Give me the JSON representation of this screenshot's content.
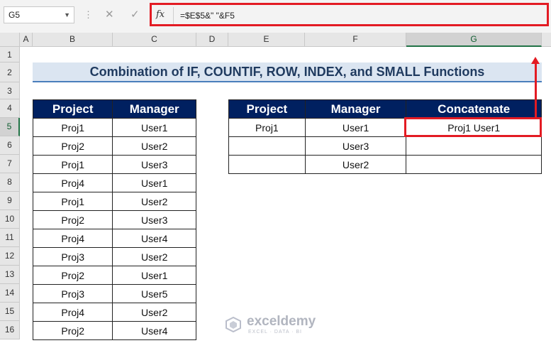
{
  "formula_bar": {
    "name_box": "G5",
    "cancel_icon": "cancel-icon",
    "enter_icon": "check-icon",
    "fx_label": "fx",
    "formula": "=$E$5&\" \"&F5"
  },
  "columns": [
    "A",
    "B",
    "C",
    "D",
    "E",
    "F",
    "G"
  ],
  "rows": [
    "1",
    "2",
    "3",
    "4",
    "5",
    "6",
    "7",
    "8",
    "9",
    "10",
    "11",
    "12",
    "13",
    "14",
    "15",
    "16"
  ],
  "selected_cell": {
    "column": "G",
    "row": "5"
  },
  "title": "Combination of IF, COUNTIF, ROW, INDEX, and SMALL Functions",
  "source_table": {
    "headers": [
      "Project",
      "Manager"
    ],
    "rows": [
      [
        "Proj1",
        "User1"
      ],
      [
        "Proj2",
        "User2"
      ],
      [
        "Proj1",
        "User3"
      ],
      [
        "Proj4",
        "User1"
      ],
      [
        "Proj1",
        "User2"
      ],
      [
        "Proj2",
        "User3"
      ],
      [
        "Proj4",
        "User4"
      ],
      [
        "Proj3",
        "User2"
      ],
      [
        "Proj2",
        "User1"
      ],
      [
        "Proj3",
        "User5"
      ],
      [
        "Proj4",
        "User2"
      ],
      [
        "Proj2",
        "User4"
      ]
    ]
  },
  "result_table": {
    "headers": [
      "Project",
      "Manager",
      "Concatenate"
    ],
    "rows": [
      [
        "Proj1",
        "User1",
        "Proj1 User1"
      ],
      [
        "",
        "User3",
        ""
      ],
      [
        "",
        "User2",
        ""
      ]
    ]
  },
  "watermark": {
    "brand": "exceldemy",
    "tagline": "EXCEL · DATA · BI"
  },
  "colors": {
    "header_bg": "#002060",
    "highlight": "#e31b23",
    "title_bg": "#dbe5f1",
    "selection": "#217346"
  }
}
